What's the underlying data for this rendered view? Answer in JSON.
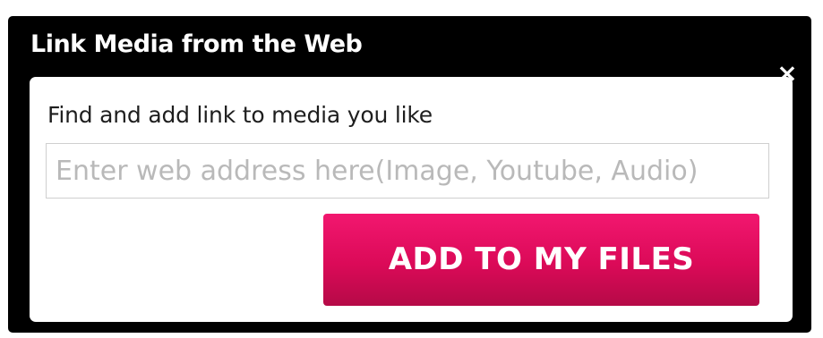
{
  "dialog": {
    "title": "Link Media from the Web",
    "close_label": "×",
    "body_label": "Find and add link to media you like",
    "url_input": {
      "placeholder": "Enter web address here(Image, Youtube, Audio)",
      "value": ""
    },
    "submit_label": "ADD TO MY FILES"
  },
  "colors": {
    "dialog_frame": "#000000",
    "button_accent": "#e0115f",
    "input_border": "#cfcfcf",
    "placeholder": "#b9b9b9"
  }
}
